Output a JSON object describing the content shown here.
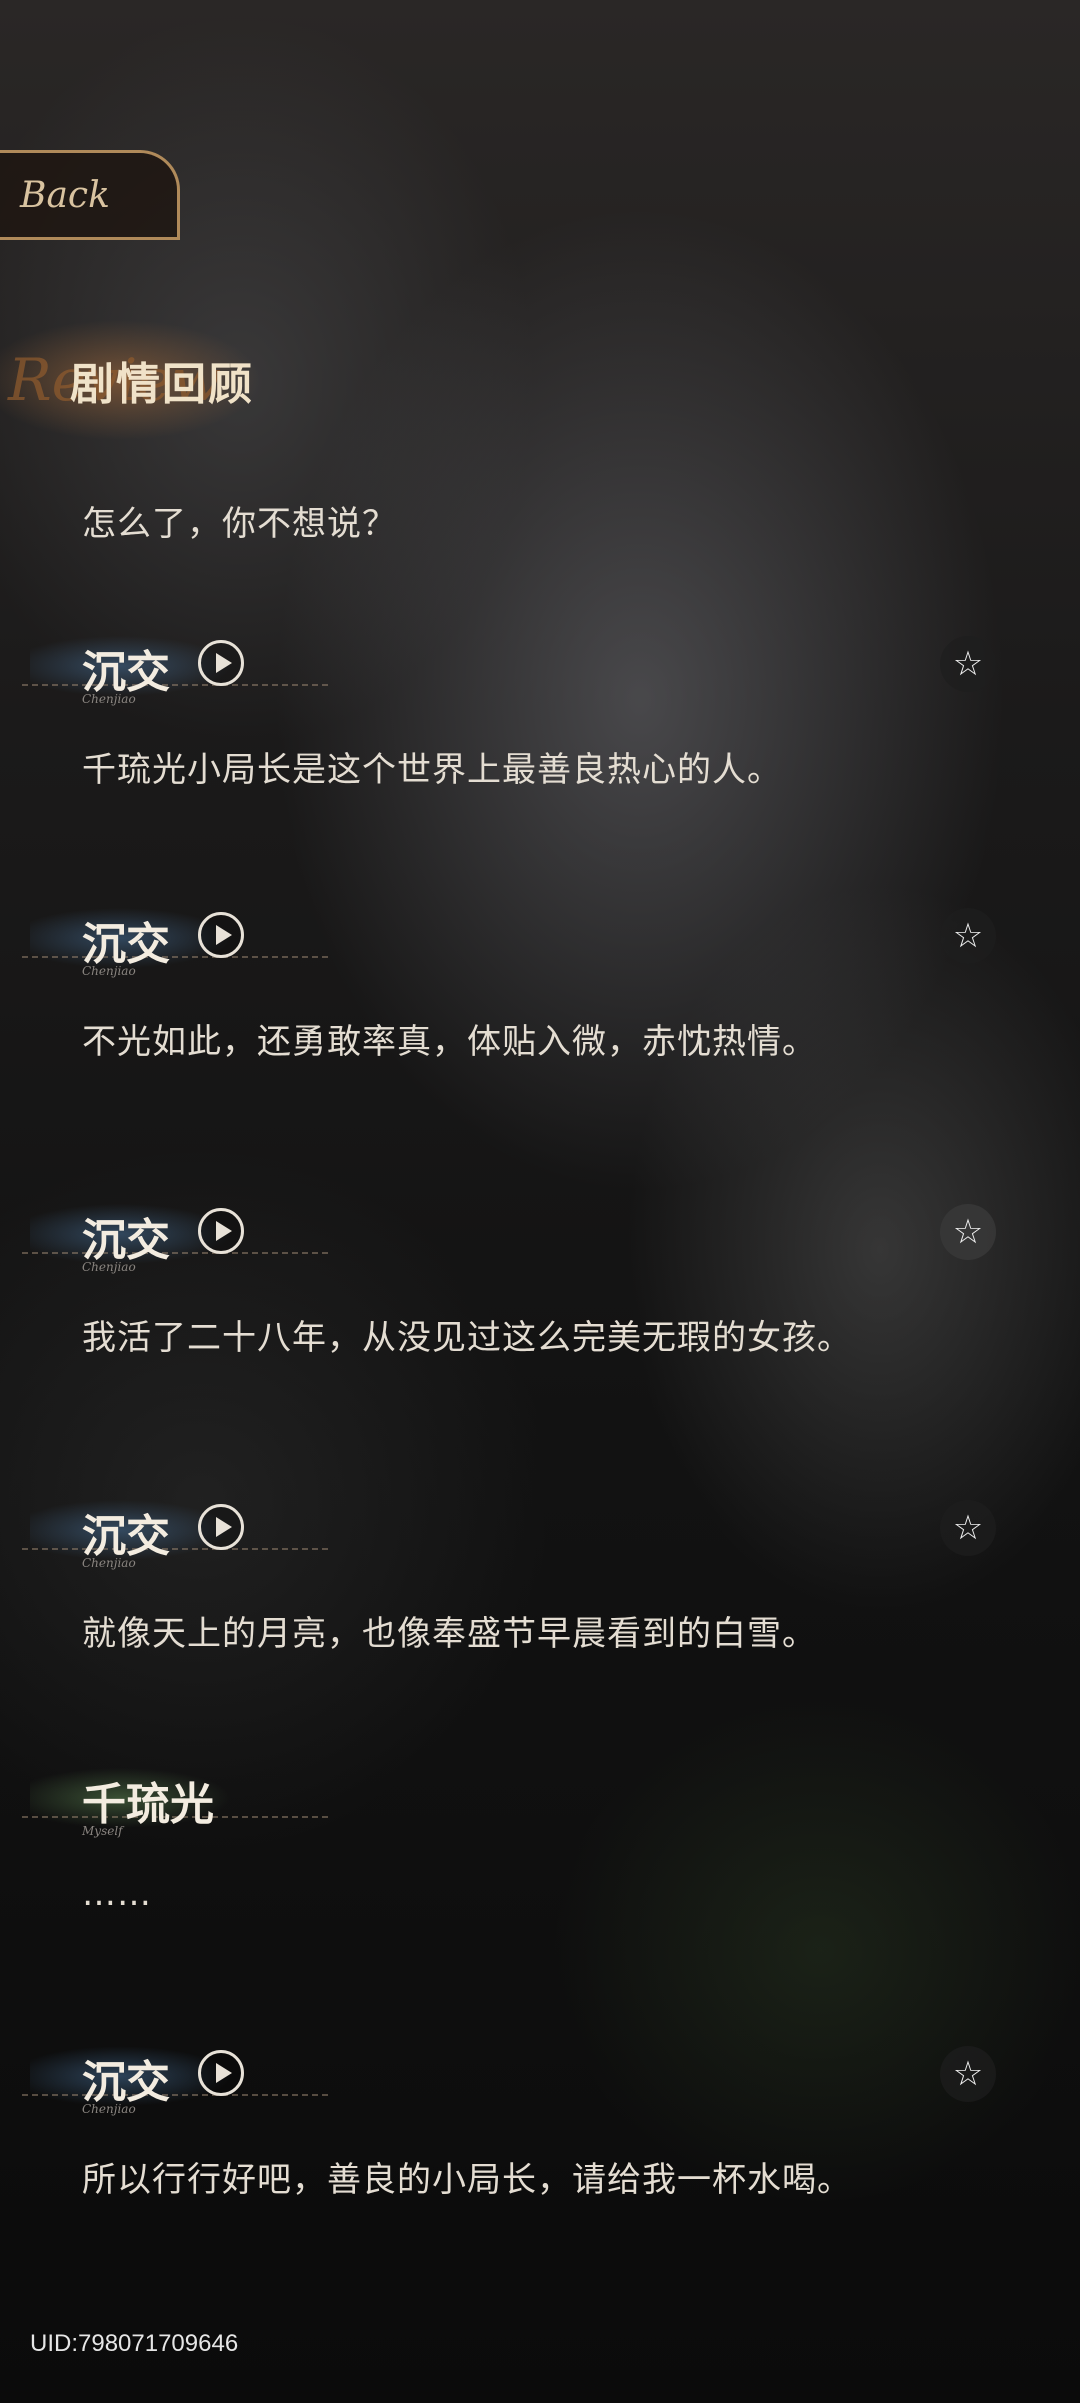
{
  "header": {
    "back_label": "Back",
    "title": "剧情回顾",
    "title_deco": "Review"
  },
  "intro_line": "怎么了，你不想说？",
  "entries": [
    {
      "speaker": "沉交",
      "speaker_sub": "Chenjiao",
      "text": "千琉光小局长是这个世界上最善良热心的人。",
      "voice": true,
      "star": "☆"
    },
    {
      "speaker": "沉交",
      "speaker_sub": "Chenjiao",
      "text": "不光如此，还勇敢率真，体贴入微，赤忱热情。",
      "voice": true,
      "star": "☆"
    },
    {
      "speaker": "沉交",
      "speaker_sub": "Chenjiao",
      "text": "我活了二十八年，从没见过这么完美无瑕的女孩。",
      "voice": true,
      "star": "☆"
    },
    {
      "speaker": "沉交",
      "speaker_sub": "Chenjiao",
      "text": "就像天上的月亮，也像奉盛节早晨看到的白雪。",
      "voice": true,
      "star": "☆"
    },
    {
      "speaker": "千琉光",
      "speaker_sub": "Myself",
      "text": "……",
      "voice": false
    },
    {
      "speaker": "沉交",
      "speaker_sub": "Chenjiao",
      "text": "所以行行好吧，善良的小局长，请给我一杯水喝。",
      "voice": true,
      "star": "☆"
    }
  ],
  "footer": {
    "uid": "UID:798071709646"
  }
}
